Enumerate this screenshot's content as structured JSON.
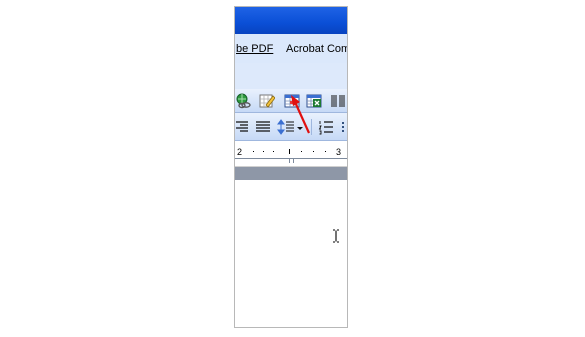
{
  "menubar": {
    "items": [
      {
        "label": "be PDF"
      },
      {
        "label": "Acrobat Com"
      }
    ]
  },
  "ruler": {
    "left_number": "2",
    "right_number": "3"
  },
  "colors": {
    "titlebar": "#0a4fd6",
    "menubar": "#dbe8fb",
    "gray_band": "#8e97a7",
    "arrow": "#e01010"
  },
  "toolbar": {
    "row1_icons": [
      "hyperlink-icon",
      "tables-borders-icon",
      "insert-table-icon",
      "insert-excel-worksheet-icon",
      "columns-icon"
    ],
    "row2_icons": [
      "align-right-icon",
      "justify-icon",
      "line-spacing-icon",
      "line-spacing-dropdown-icon",
      "numbering-icon",
      "toolbar-options-icon"
    ]
  }
}
